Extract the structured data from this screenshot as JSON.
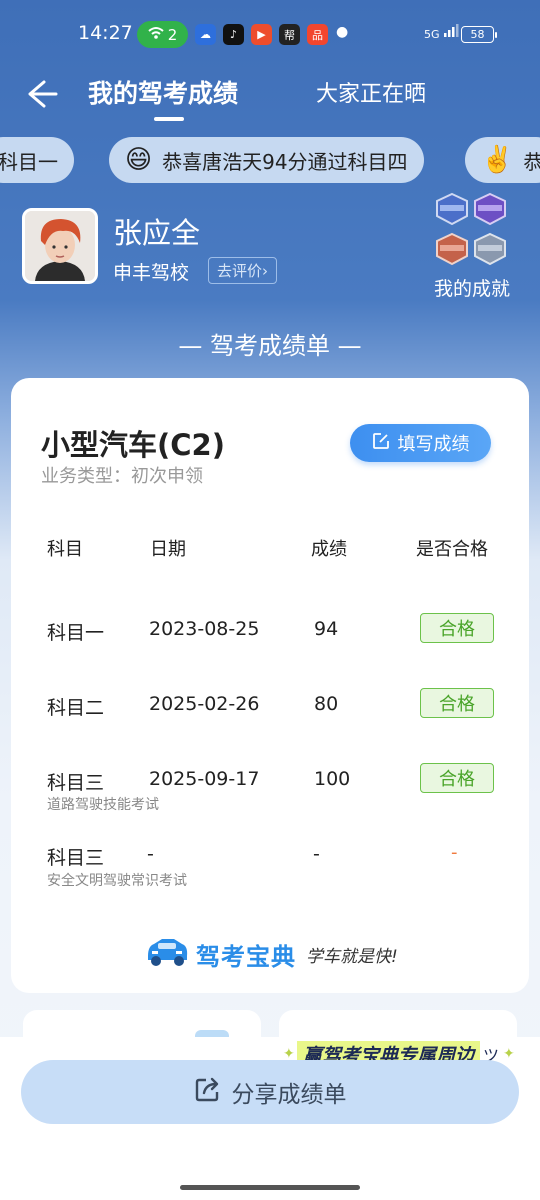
{
  "status_bar": {
    "time": "14:27",
    "wifi_count": "2",
    "network": "5G",
    "battery": "58",
    "apps": [
      {
        "icon": "baidu-netdisk-icon",
        "color": "#2e6fdc",
        "glyph": "☁"
      },
      {
        "icon": "tiktok-icon",
        "color": "#111111",
        "glyph": "♪"
      },
      {
        "icon": "video-app-icon",
        "color": "#ee4d2d",
        "glyph": "▶"
      },
      {
        "icon": "news-app-icon",
        "color": "#222222",
        "glyph": "帮"
      },
      {
        "icon": "red-app-icon",
        "color": "#f2462f",
        "glyph": "品"
      }
    ]
  },
  "nav": {
    "title": "我的驾考成绩",
    "other_tab": "大家正在晒"
  },
  "ticker": [
    {
      "emoji": "",
      "text": "科目一"
    },
    {
      "emoji": "😄",
      "text": "恭喜唐浩天94分通过科目四"
    },
    {
      "emoji": "✌️",
      "text": "恭"
    }
  ],
  "profile": {
    "name": "张应全",
    "school": "申丰驾校",
    "rate_label": "去评价",
    "achievements_label": "我的成就"
  },
  "section_title": "— 驾考成绩单 —",
  "card": {
    "license_type": "小型汽车(C2)",
    "business_type": "业务类型：初次申领",
    "fill_button": "填写成绩",
    "headers": {
      "subject": "科目",
      "date": "日期",
      "score": "成绩",
      "passed": "是否合格"
    },
    "rows": [
      {
        "subject": "科目一",
        "sub": "",
        "date": "2023-08-25",
        "score": "94",
        "result": "合格"
      },
      {
        "subject": "科目二",
        "sub": "",
        "date": "2025-02-26",
        "score": "80",
        "result": "合格"
      },
      {
        "subject": "科目三",
        "sub": "道路驾驶技能考试",
        "date": "2025-09-17",
        "score": "100",
        "result": "合格"
      },
      {
        "subject": "科目三",
        "sub": "安全文明驾驶常识考试",
        "date": "-",
        "score": "-",
        "result": "-"
      }
    ],
    "brand_name": "驾考宝典",
    "brand_slogan": "学车就是快!"
  },
  "promo_text": "赢驾考宝典专属周边",
  "share_button": "分享成绩单",
  "colors": {
    "header_bg": "#3f6fb8",
    "accent": "#3d8ff0",
    "pass_green": "#4aa42a",
    "promo_yellow": "#e9f78a"
  }
}
